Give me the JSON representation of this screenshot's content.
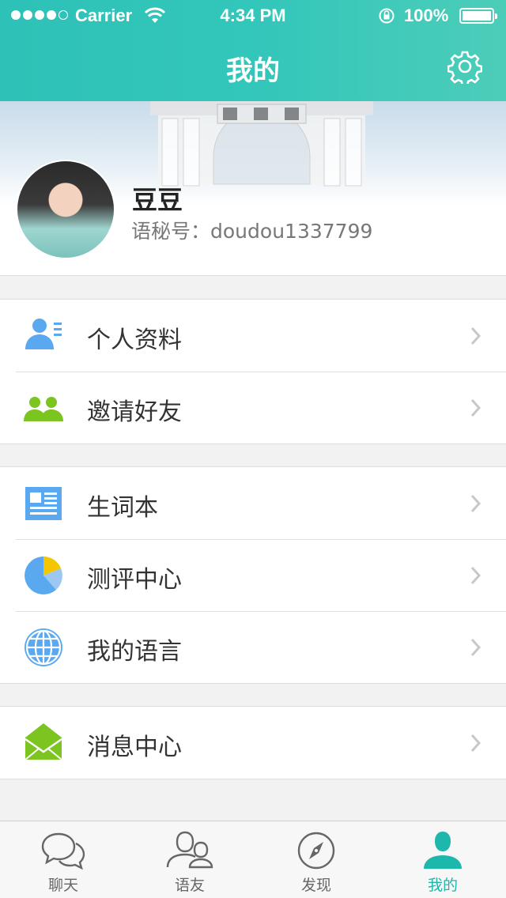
{
  "status_bar": {
    "carrier": "Carrier",
    "time": "4:34 PM",
    "battery": "100%"
  },
  "header": {
    "title": "我的"
  },
  "profile": {
    "name": "豆豆",
    "id_label": "语秘号：",
    "id_value": "doudou1337799"
  },
  "groups": [
    [
      {
        "label": "个人资料",
        "icon": "profile-card-icon"
      },
      {
        "label": "邀请好友",
        "icon": "invite-friends-icon"
      }
    ],
    [
      {
        "label": "生词本",
        "icon": "vocabulary-book-icon"
      },
      {
        "label": "测评中心",
        "icon": "pie-chart-icon"
      },
      {
        "label": "我的语言",
        "icon": "globe-icon"
      }
    ],
    [
      {
        "label": "消息中心",
        "icon": "envelope-icon"
      }
    ]
  ],
  "tabs": [
    {
      "label": "聊天",
      "icon": "chat-bubbles-icon",
      "active": false
    },
    {
      "label": "语友",
      "icon": "friends-icon",
      "active": false
    },
    {
      "label": "发现",
      "icon": "compass-icon",
      "active": false
    },
    {
      "label": "我的",
      "icon": "person-icon",
      "active": true
    }
  ],
  "colors": {
    "accent": "#1eb7ab",
    "header_gradient": "#2ec1b7",
    "blue_icon": "#5aa9f0",
    "green_icon": "#7cc520"
  }
}
